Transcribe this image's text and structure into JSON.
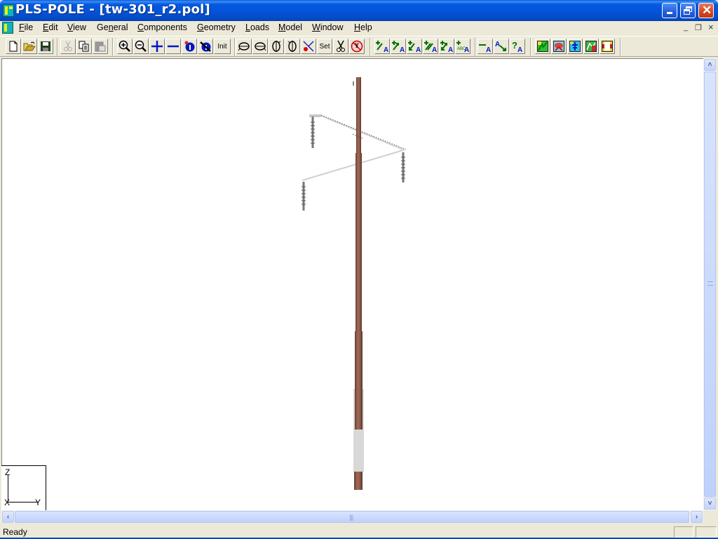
{
  "window": {
    "title": "PLS-POLE - [tw-301_r2.pol]",
    "controls": {
      "minimize": "_",
      "restore": "❐",
      "close": "✕"
    }
  },
  "menubar": {
    "items": [
      {
        "label": "File",
        "underline": "F"
      },
      {
        "label": "Edit",
        "underline": "E"
      },
      {
        "label": "View",
        "underline": "V"
      },
      {
        "label": "General",
        "underline": "n"
      },
      {
        "label": "Components",
        "underline": "C"
      },
      {
        "label": "Geometry",
        "underline": "G"
      },
      {
        "label": "Loads",
        "underline": "L"
      },
      {
        "label": "Model",
        "underline": "M"
      },
      {
        "label": "Window",
        "underline": "W"
      },
      {
        "label": "Help",
        "underline": "H"
      }
    ],
    "mdi_controls": {
      "minimize": "_",
      "restore": "❐",
      "close": "×"
    }
  },
  "toolbar": {
    "file": [
      {
        "name": "new-icon",
        "enabled": true
      },
      {
        "name": "open-icon",
        "enabled": true
      },
      {
        "name": "save-icon",
        "enabled": true
      }
    ],
    "edit": [
      {
        "name": "cut-icon",
        "enabled": false
      },
      {
        "name": "copy-icon",
        "enabled": true
      },
      {
        "name": "paste-icon",
        "enabled": false
      }
    ],
    "view": [
      {
        "name": "zoom-in-icon"
      },
      {
        "name": "zoom-out-icon"
      },
      {
        "name": "enlarge-icon"
      },
      {
        "name": "shrink-icon"
      },
      {
        "name": "info-icon"
      },
      {
        "name": "info-hide-icon"
      },
      {
        "name": "init-view",
        "label": "Init"
      }
    ],
    "rotate": [
      {
        "name": "rotate-x-ccw-icon"
      },
      {
        "name": "rotate-x-cw-icon"
      },
      {
        "name": "rotate-z-ccw-icon"
      },
      {
        "name": "rotate-z-cw-icon"
      },
      {
        "name": "select-joints-icon"
      },
      {
        "name": "set-view",
        "label": "Set"
      },
      {
        "name": "cut-view-icon"
      },
      {
        "name": "no-cut-icon"
      }
    ],
    "labels": [
      {
        "name": "label-add-1-icon"
      },
      {
        "name": "label-add-2-icon"
      },
      {
        "name": "label-add-3-icon"
      },
      {
        "name": "label-add-4-icon"
      },
      {
        "name": "label-add-5-icon"
      },
      {
        "name": "label-add-abc-icon"
      }
    ],
    "annotate": [
      {
        "name": "label-line-icon"
      },
      {
        "name": "label-arrow-icon"
      },
      {
        "name": "label-query-icon"
      }
    ],
    "render": [
      {
        "name": "render-3d-icon"
      },
      {
        "name": "render-deflection-icon"
      },
      {
        "name": "render-model-icon"
      },
      {
        "name": "render-stress-icon"
      },
      {
        "name": "render-section-icon"
      }
    ]
  },
  "viewport": {
    "axes": {
      "z": "Z",
      "x": "X",
      "y": "Y"
    },
    "colors": {
      "pole": "#8b5a48",
      "pole_dark": "#6a3f30",
      "arm": "#c8c8c8",
      "insulator": "#777777",
      "base": "#d6d6d6"
    }
  },
  "scrollbars": {
    "up": "˄",
    "down": "˅",
    "left": "‹",
    "right": "›",
    "grip": "||||"
  },
  "statusbar": {
    "text": "Ready"
  }
}
